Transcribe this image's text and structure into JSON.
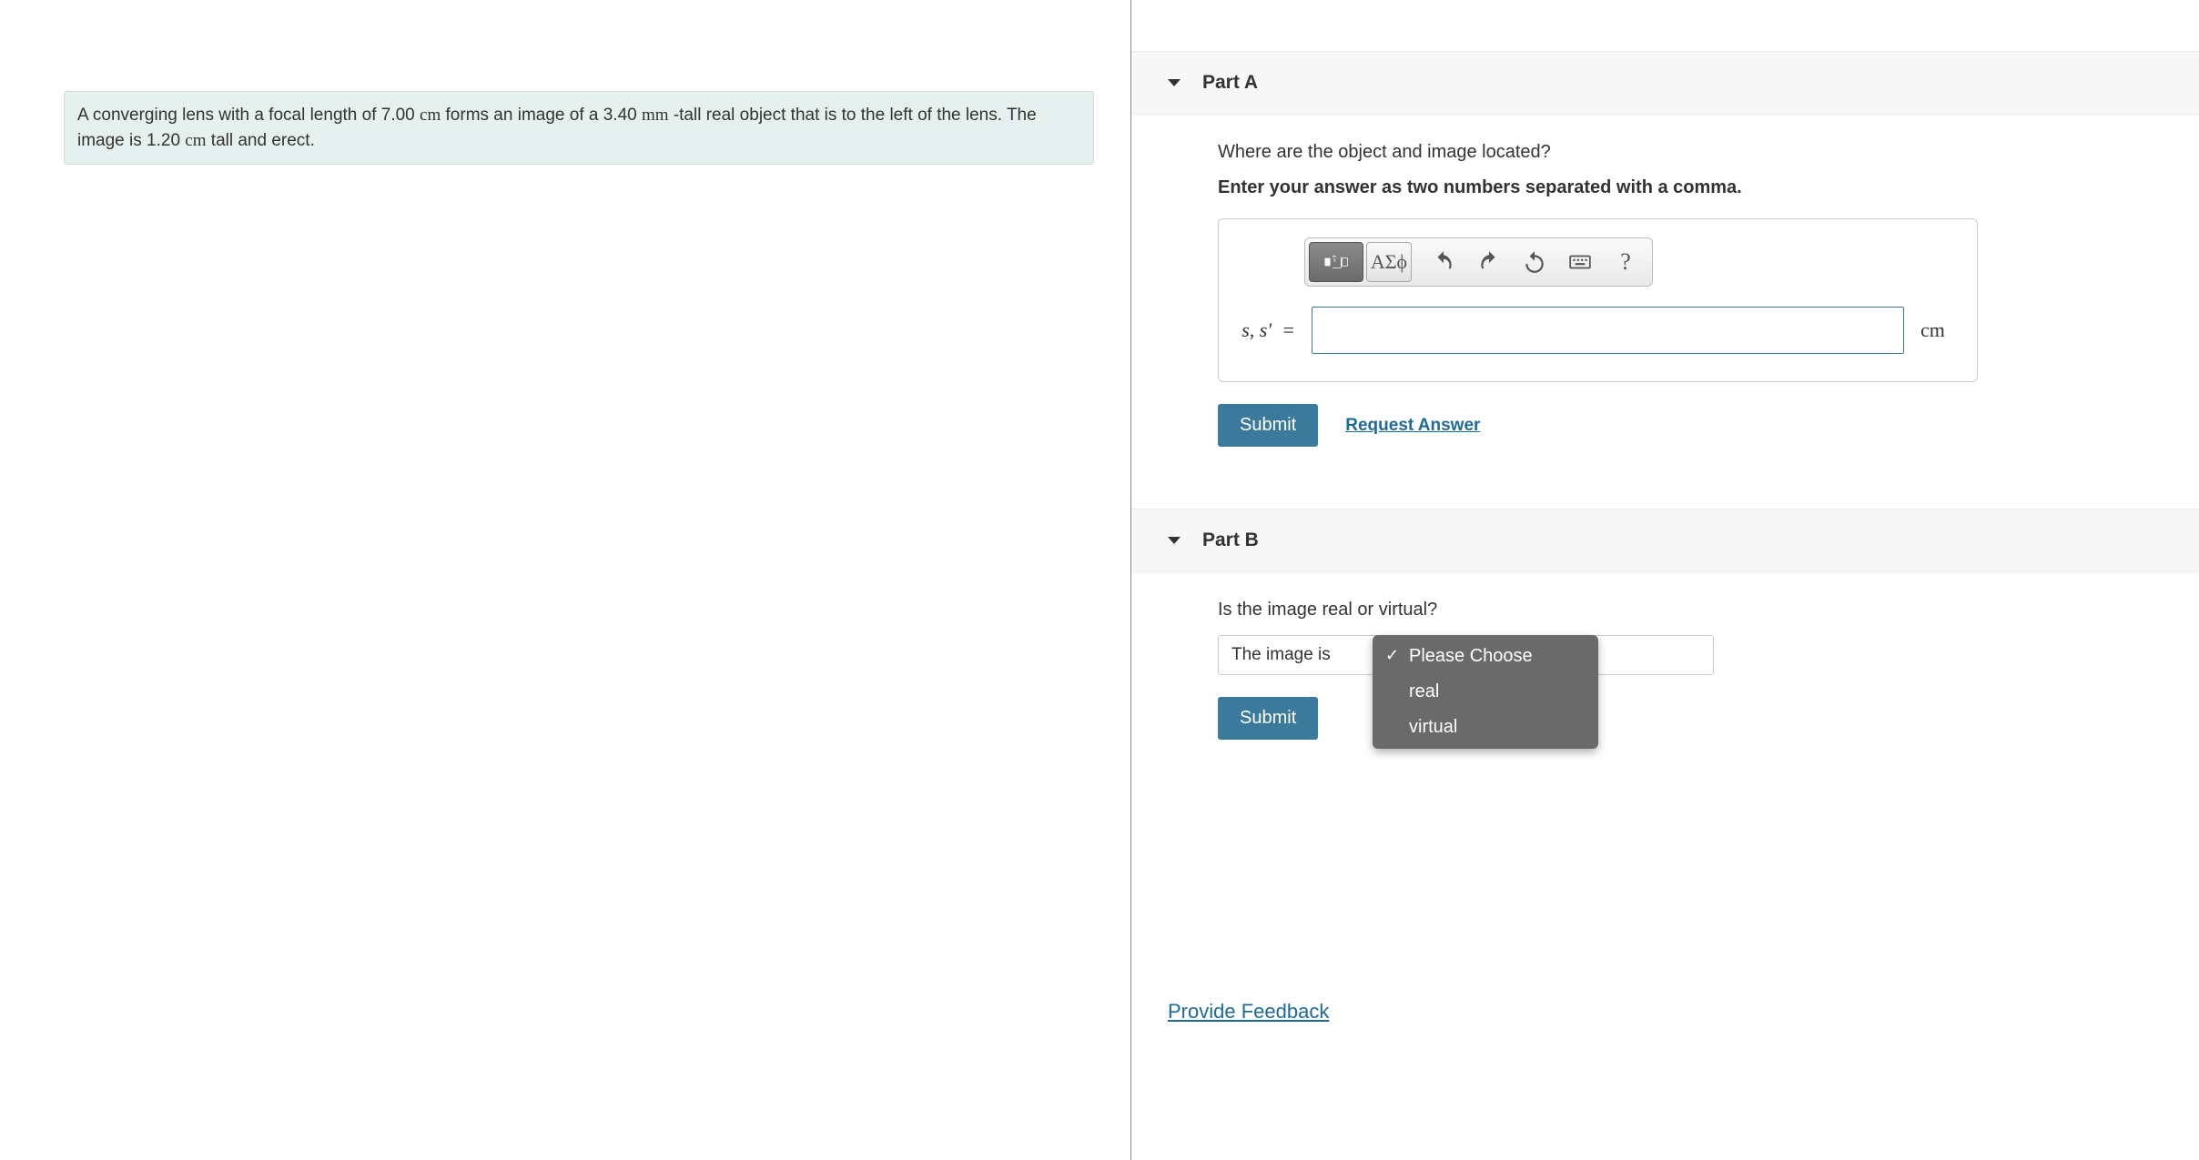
{
  "problem": {
    "text_1": "A converging lens with a focal length of 7.00 ",
    "unit_1": "cm",
    "text_2": " forms an image of a 3.40 ",
    "unit_2": "mm",
    "text_3": " -tall real object that is to the left of the lens. The image is 1.20 ",
    "unit_3": "cm",
    "text_4": " tall and erect."
  },
  "partA": {
    "title": "Part A",
    "question": "Where are the object and image located?",
    "instruction": "Enter your answer as two numbers separated with a comma.",
    "toolbar": {
      "greek": "ΑΣϕ",
      "help": "?"
    },
    "label_html": "s, s′  =",
    "unit": "cm",
    "submit": "Submit",
    "request": "Request Answer"
  },
  "partB": {
    "title": "Part B",
    "question": "Is the image real or virtual?",
    "prefix": "The image is",
    "options": {
      "placeholder": "Please Choose",
      "opt1": "real",
      "opt2": "virtual"
    },
    "submit": "Submit"
  },
  "feedback": "Provide Feedback"
}
